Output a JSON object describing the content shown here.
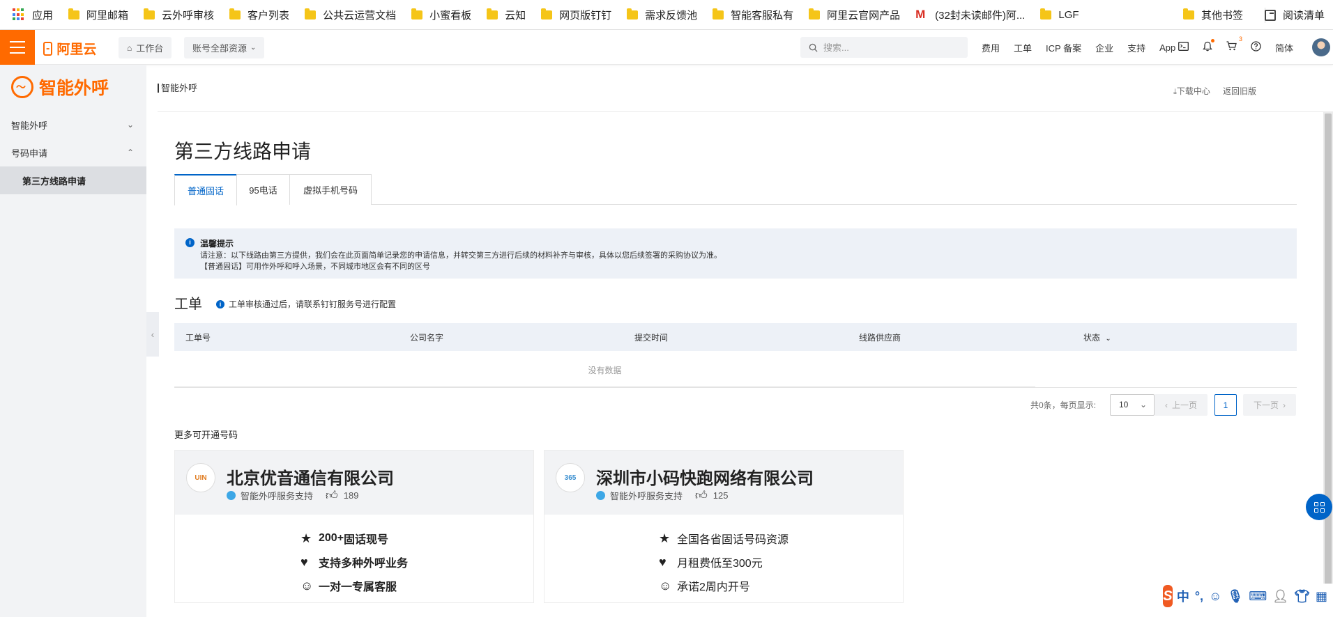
{
  "bookmarks": {
    "items": [
      {
        "label": "应用",
        "icon": "apps-grid-icon"
      },
      {
        "label": "阿里邮箱",
        "icon": "folder-icon"
      },
      {
        "label": "云外呼审核",
        "icon": "folder-icon"
      },
      {
        "label": "客户列表",
        "icon": "folder-icon"
      },
      {
        "label": "公共云运营文档",
        "icon": "folder-icon"
      },
      {
        "label": "小蜜看板",
        "icon": "folder-icon"
      },
      {
        "label": "云知",
        "icon": "folder-icon"
      },
      {
        "label": "网页版钉钉",
        "icon": "folder-icon"
      },
      {
        "label": "需求反馈池",
        "icon": "folder-icon"
      },
      {
        "label": "智能客服私有",
        "icon": "folder-icon"
      },
      {
        "label": "阿里云官网产品",
        "icon": "folder-icon"
      },
      {
        "label": "(32封未读邮件)阿...",
        "icon": "gmail-icon"
      },
      {
        "label": "LGF",
        "icon": "folder-icon"
      }
    ],
    "other": "其他书签",
    "reading_list": "阅读清单"
  },
  "topbar": {
    "logo_text": "阿里云",
    "workbench": "工作台",
    "resources": "账号全部资源",
    "search_placeholder": "搜索...",
    "links": [
      "费用",
      "工单",
      "ICP 备案",
      "企业",
      "支持",
      "App"
    ],
    "cart_count": "3",
    "language": "简体"
  },
  "sidebar": {
    "product": "智能外呼",
    "items": [
      {
        "label": "智能外呼",
        "expanded": false
      },
      {
        "label": "号码申请",
        "expanded": true
      }
    ],
    "sub_items": [
      "第三方线路申请"
    ]
  },
  "subheader": {
    "breadcrumb": "智能外呼",
    "download_center": "下载中心",
    "back_old": "返回旧版"
  },
  "main": {
    "title": "第三方线路申请",
    "tabs": [
      "普通固话",
      "95电话",
      "虚拟手机号码"
    ],
    "active_tab": 0,
    "notice": {
      "title": "温馨提示",
      "line1": "请注意：以下线路由第三方提供，我们会在此页面简单记录您的申请信息，并转交第三方进行后续的材料补齐与审核，具体以您后续签署的采购协议为准。",
      "line2": "【普通固话】可用作外呼和呼入场景，不同城市地区会有不同的区号"
    },
    "section_title": "工单",
    "section_tip": "工单审核通过后，请联系钉钉服务号进行配置",
    "table": {
      "columns": [
        "工单号",
        "公司名字",
        "提交时间",
        "线路供应商",
        "状态"
      ],
      "empty": "没有数据"
    },
    "pager": {
      "total": "共0条，每页显示:",
      "page_size": "10",
      "prev": "上一页",
      "current": "1",
      "next": "下一页"
    },
    "more_title": "更多可开通号码",
    "cards": [
      {
        "logo_text": "UIN",
        "name": "北京优音通信有限公司",
        "support": "智能外呼服务支持",
        "likes": "189",
        "features": [
          {
            "icon": "star-icon",
            "bold": "200+",
            "text": "固话现号"
          },
          {
            "icon": "heart-icon",
            "bold": "",
            "text": "支持多种外呼业务"
          },
          {
            "icon": "smile-icon",
            "bold": "",
            "text": "一对一专属客服"
          }
        ]
      },
      {
        "logo_text": "365",
        "name": "深圳市小码快跑网络有限公司",
        "support": "智能外呼服务支持",
        "likes": "125",
        "features": [
          {
            "icon": "star-icon",
            "bold": "",
            "text": "全国各省固话号码资源"
          },
          {
            "icon": "heart-icon",
            "bold": "",
            "text": "月租费低至300元"
          },
          {
            "icon": "smile-icon",
            "bold": "",
            "text": "承诺2周内开号"
          }
        ]
      }
    ]
  },
  "ime": {
    "mode": "中"
  },
  "colors": {
    "brand": "#ff6a00",
    "accent": "#0064c8"
  }
}
